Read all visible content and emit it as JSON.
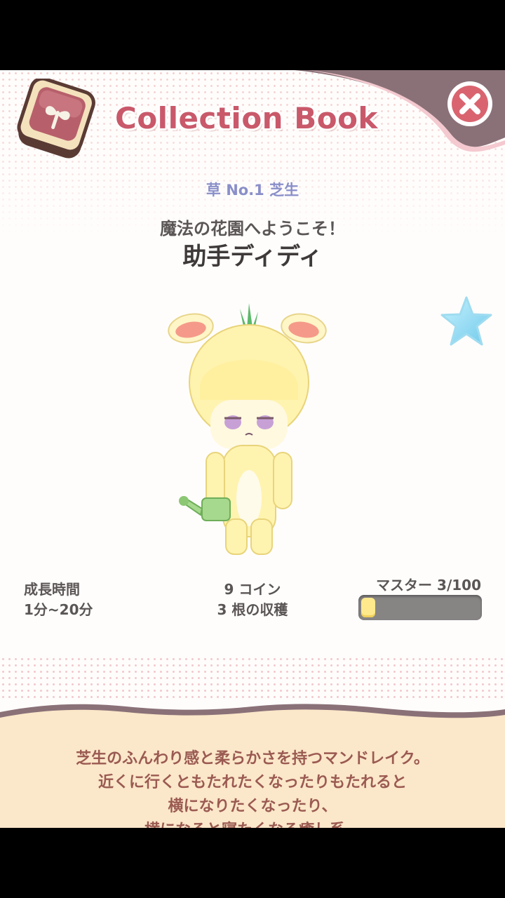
{
  "header": {
    "title": "Collection Book",
    "close_icon": "close-x-icon",
    "book_icon": "collection-book-icon"
  },
  "entry": {
    "category": "草 No.1 芝生",
    "greeting": "魔法の花園へようこそ！",
    "name": "助手ディディ",
    "favorite_icon": "star-icon"
  },
  "stats": {
    "growth_label": "成長時間",
    "growth_value": "1分~20分",
    "coins": "9 コイン",
    "harvest": "3 根の収穫",
    "mastery_label": "マスター 3/100",
    "mastery_progress": 0.03
  },
  "description": {
    "lines": [
      "芝生のふんわり感と柔らかさを持つマンドレイク。",
      "近くに行くともたれたくなったりもたれると",
      "横になりたくなったり、",
      "横になると寝たくなる癒し系。"
    ]
  },
  "colors": {
    "title": "#c9596a",
    "category": "#8a8fc9",
    "description": "#9a5a52",
    "mastery_fill": "#ffe98c",
    "panel_bottom": "#fbe7c9"
  }
}
